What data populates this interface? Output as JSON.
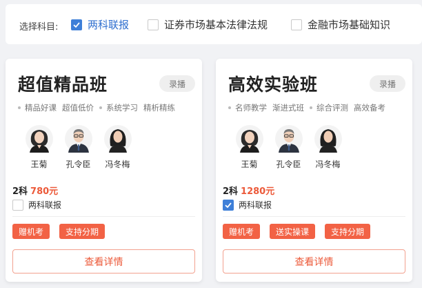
{
  "subject_filter": {
    "label": "选择科目:",
    "options": [
      {
        "label": "两科联报",
        "checked": true
      },
      {
        "label": "证券市场基本法律法规",
        "checked": false
      },
      {
        "label": "金融市场基础知识",
        "checked": false
      }
    ]
  },
  "cards": [
    {
      "title": "超值精品班",
      "badge": "录播",
      "features": [
        "精品好课",
        "超值低价",
        "系统学习",
        "精析精练"
      ],
      "teachers": [
        {
          "name": "王菊",
          "avatar": "female-teacher-avatar"
        },
        {
          "name": "孔令臣",
          "avatar": "male-teacher-avatar"
        },
        {
          "name": "冯冬梅",
          "avatar": "female-teacher-avatar"
        }
      ],
      "price_count": "2科",
      "price": "780元",
      "bundle_label": "两科联报",
      "bundle_checked": false,
      "tags": [
        "赠机考",
        "支持分期"
      ],
      "detail_button": "查看详情"
    },
    {
      "title": "高效实验班",
      "badge": "录播",
      "features": [
        "名师教学",
        "渐进式班",
        "综合评测",
        "高效备考"
      ],
      "teachers": [
        {
          "name": "王菊",
          "avatar": "female-teacher-avatar"
        },
        {
          "name": "孔令臣",
          "avatar": "male-teacher-avatar"
        },
        {
          "name": "冯冬梅",
          "avatar": "female-teacher-avatar"
        }
      ],
      "price_count": "2科",
      "price": "1280元",
      "bundle_label": "两科联报",
      "bundle_checked": true,
      "tags": [
        "赠机考",
        "送实操课",
        "支持分期"
      ],
      "detail_button": "查看详情"
    }
  ],
  "colors": {
    "accent_blue": "#3e7fd8",
    "accent_orange": "#ec5a3a",
    "tag_bg": "#f26245"
  }
}
